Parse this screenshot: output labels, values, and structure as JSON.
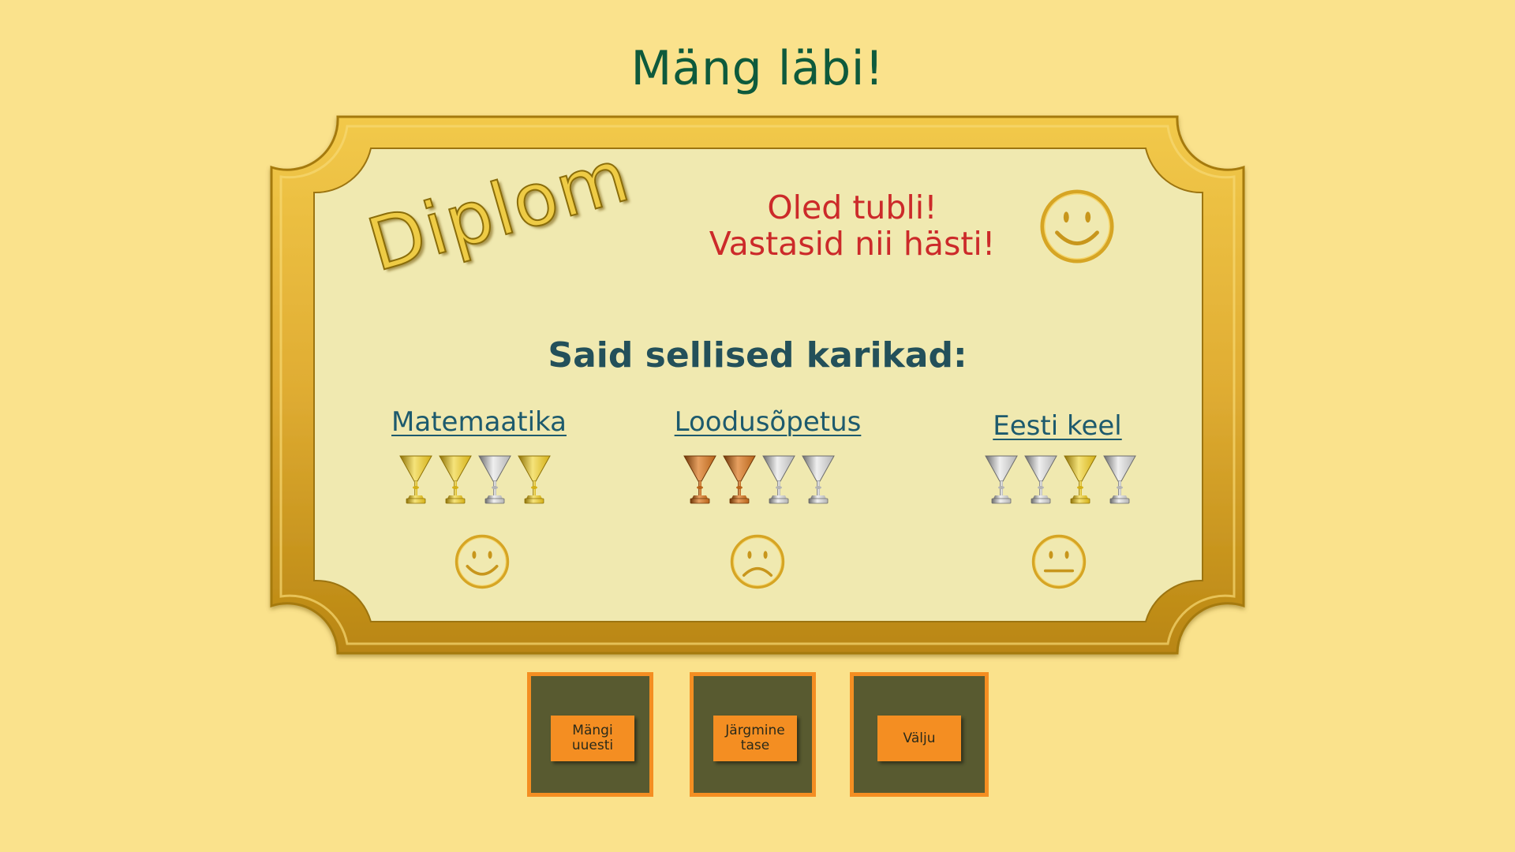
{
  "title": "Mäng läbi!",
  "diploma": {
    "word": "Diplom",
    "praise_line1": "Oled tubli!",
    "praise_line2": "Vastasid nii hästi!",
    "praise_face": "smile-icon"
  },
  "trophies_heading": "Said sellised karikad:",
  "subjects": [
    {
      "name": "Matemaatika",
      "cups": [
        "gold",
        "gold",
        "silver",
        "gold"
      ],
      "face": "smile-icon"
    },
    {
      "name": "Loodusõpetus",
      "cups": [
        "bronze",
        "bronze",
        "silver",
        "silver"
      ],
      "face": "sad-icon"
    },
    {
      "name": "Eesti keel",
      "cups": [
        "silver",
        "silver",
        "gold",
        "silver"
      ],
      "face": "neutral-icon"
    }
  ],
  "buttons": {
    "play_again": "Mängi\nuuesti",
    "next_level": "Järgmine\ntase",
    "exit": "Välju"
  },
  "colors": {
    "background": "#fae28c",
    "frame_gold": "#e3b23b",
    "paper": "#f0e9b0",
    "title_green": "#0e5a3c",
    "praise_red": "#cc2a2a",
    "heading_teal": "#23505a",
    "button_orange": "#f48e22",
    "button_box": "#585a30",
    "cup_gold": "#d4b018",
    "cup_silver": "#b4b4b4",
    "cup_bronze": "#b8641a"
  }
}
